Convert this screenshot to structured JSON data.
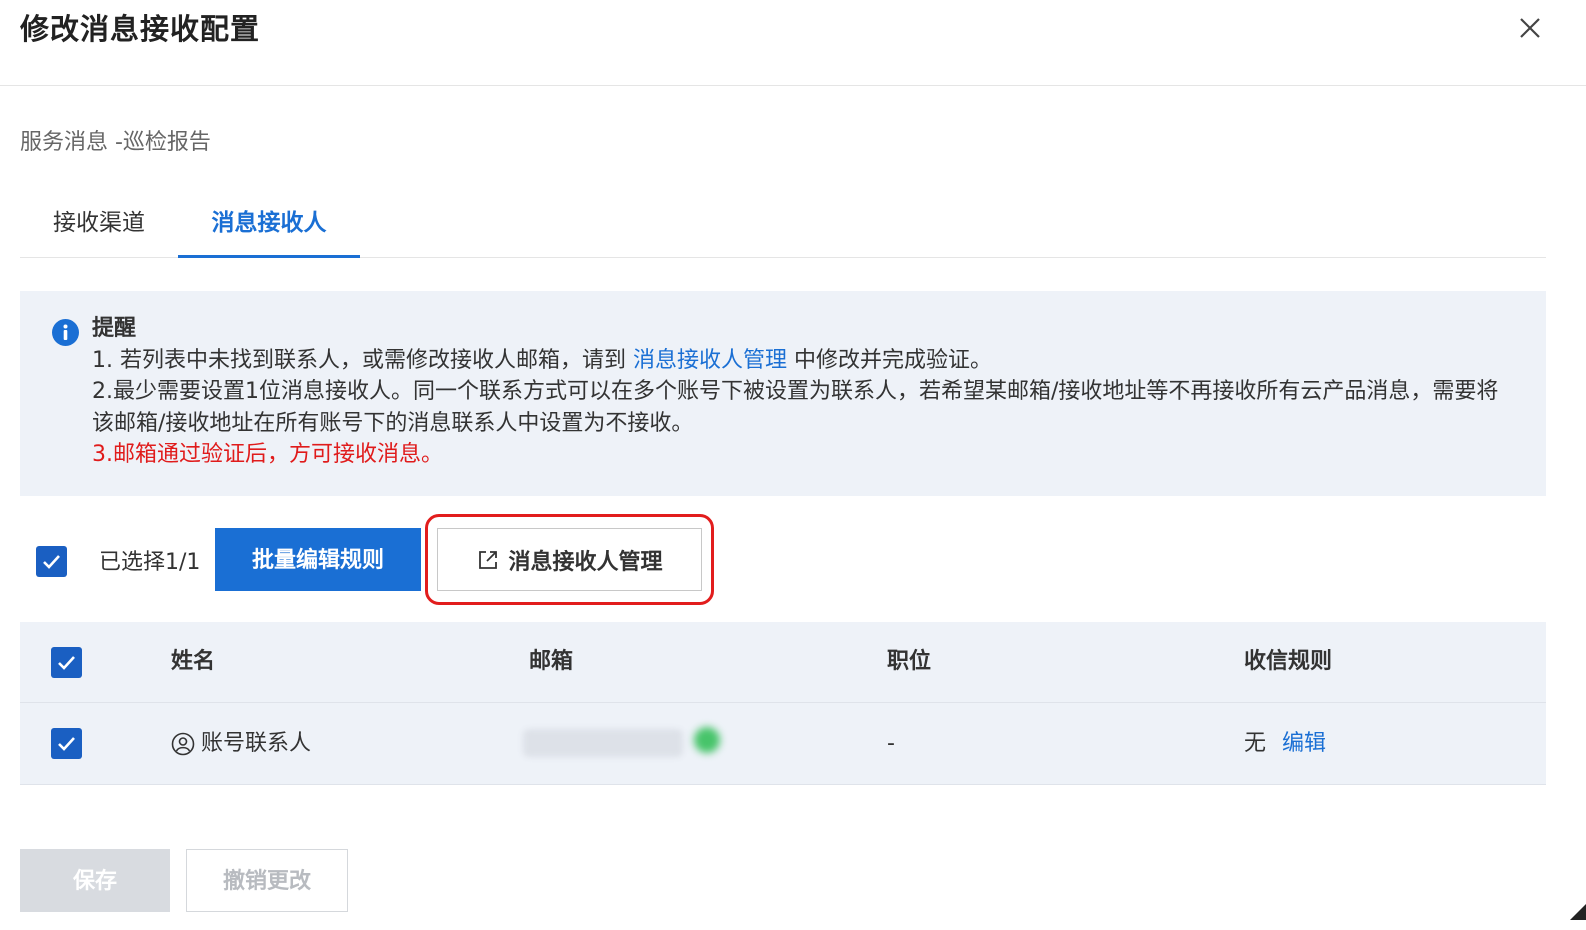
{
  "dialog": {
    "title": "修改消息接收配置"
  },
  "subtitle": "服务消息 -巡检报告",
  "tabs": [
    {
      "label": "接收渠道",
      "active": false
    },
    {
      "label": "消息接收人",
      "active": true
    }
  ],
  "notice": {
    "title": "提醒",
    "line1_prefix": "1. 若列表中未找到联系人，或需修改接收人邮箱，请到 ",
    "line1_link": "消息接收人管理",
    "line1_suffix": " 中修改并完成验证。",
    "line2": "2.最少需要设置1位消息接收人。同一个联系方式可以在多个账号下被设置为联系人，若希望某邮箱/接收地址等不再接收所有云产品消息，需要将该邮箱/接收地址在所有账号下的消息联系人中设置为不接收。",
    "line3": "3.邮箱通过验证后，方可接收消息。"
  },
  "toolbar": {
    "selected_text": "已选择1/1",
    "batch_edit_label": "批量编辑规则",
    "manage_label": "消息接收人管理"
  },
  "table": {
    "headers": [
      "姓名",
      "邮箱",
      "职位",
      "收信规则"
    ],
    "rows": [
      {
        "name": "账号联系人",
        "email": "",
        "position": "-",
        "rule": "无",
        "action": "编辑",
        "checked": true
      }
    ]
  },
  "footer": {
    "save_label": "保存",
    "revert_label": "撤销更改"
  },
  "colors": {
    "primary": "#1a6fd4",
    "warning_red": "#e01b1b",
    "notice_bg": "#eef2f8"
  }
}
